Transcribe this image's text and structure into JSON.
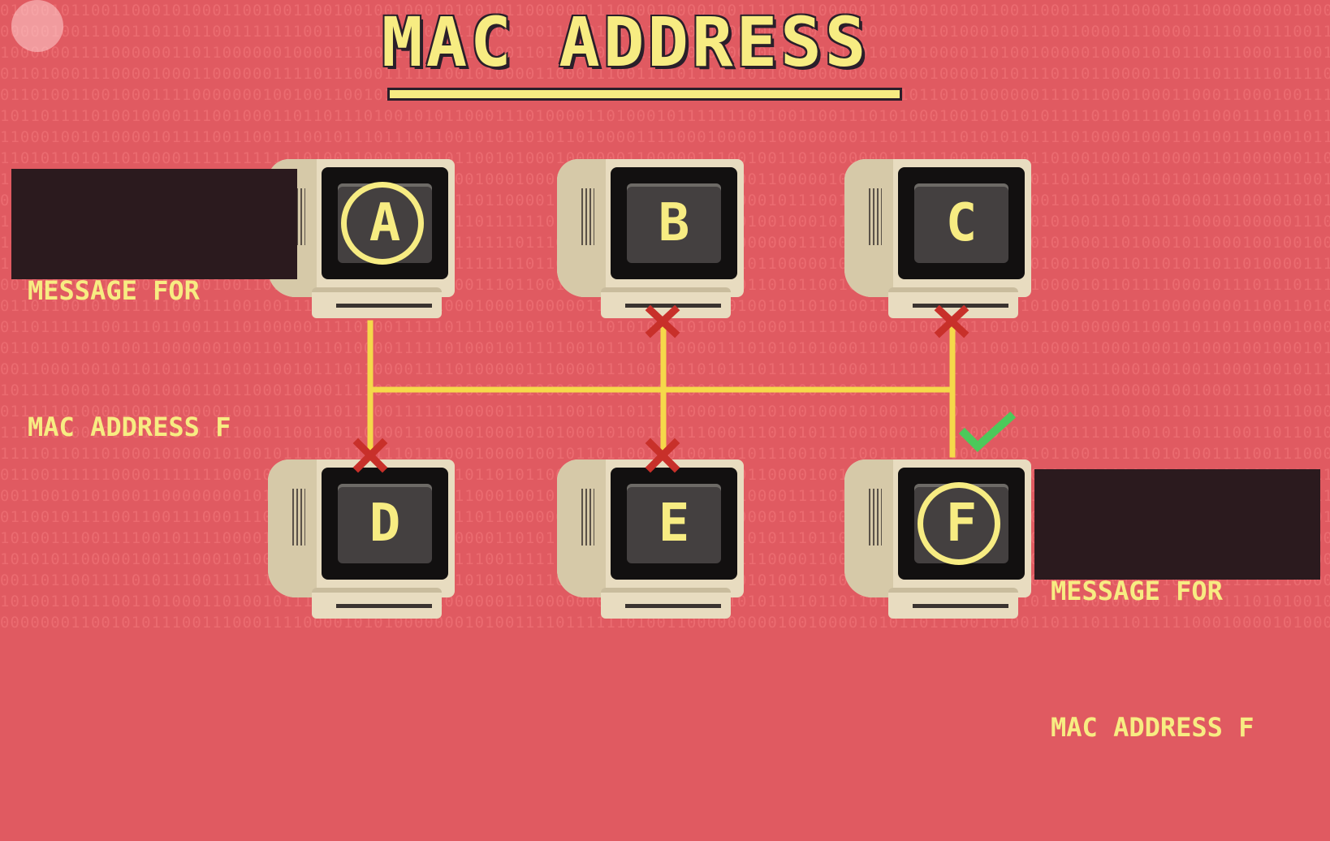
{
  "title": "MAC ADDRESS",
  "colors": {
    "background": "#e05a61",
    "accent_yellow": "#f7ec82",
    "wire_yellow": "#f5d94a",
    "x_red": "#c8302a",
    "check_green": "#4cc95a",
    "label_box": "#2b1a1e"
  },
  "message_sender": {
    "line1": "MESSAGE FOR",
    "line2": "MAC ADDRESS F"
  },
  "message_receiver": {
    "line1": "MESSAGE FOR",
    "line2": "MAC ADDRESS F"
  },
  "computers": [
    {
      "label": "A",
      "highlighted": true,
      "role": "sender"
    },
    {
      "label": "B",
      "highlighted": false,
      "status": "rejected"
    },
    {
      "label": "C",
      "highlighted": false,
      "status": "rejected"
    },
    {
      "label": "D",
      "highlighted": false,
      "status": "rejected"
    },
    {
      "label": "E",
      "highlighted": false,
      "status": "rejected"
    },
    {
      "label": "F",
      "highlighted": true,
      "status": "accepted"
    }
  ],
  "icons": {
    "logo": "pbs-head-logo",
    "reject": "x-mark-icon",
    "accept": "check-mark-icon"
  }
}
